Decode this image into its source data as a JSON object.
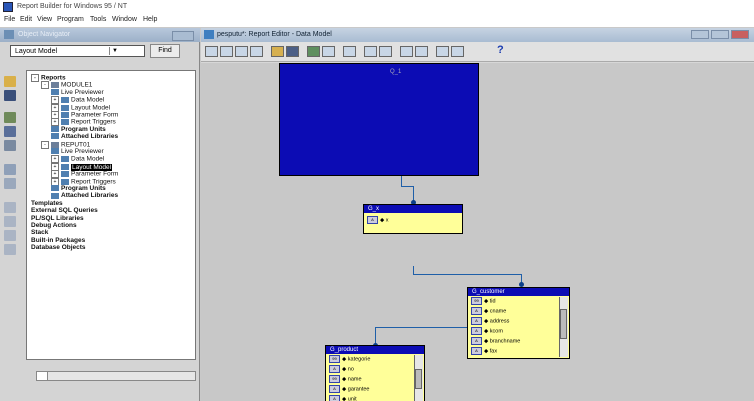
{
  "window": {
    "title": "Report Builder for Windows 95 / NT"
  },
  "menu": [
    "File",
    "Edit",
    "View",
    "Program",
    "Tools",
    "Window",
    "Help"
  ],
  "navigator": {
    "title": "Object Navigator",
    "view_select": "Layout Model",
    "find_label": "Find",
    "tree": [
      {
        "label": "Reports",
        "level": 0,
        "bold": true,
        "expander": "-"
      },
      {
        "label": "MODULE1",
        "level": 1,
        "expander": "-"
      },
      {
        "label": "Live Previewer",
        "level": 2
      },
      {
        "label": "Data Model",
        "level": 2,
        "expander": "+"
      },
      {
        "label": "Layout Model",
        "level": 2,
        "expander": "+"
      },
      {
        "label": "Parameter Form",
        "level": 2,
        "expander": "+"
      },
      {
        "label": "Report Triggers",
        "level": 2,
        "expander": "+"
      },
      {
        "label": "Program Units",
        "level": 2,
        "bold": true
      },
      {
        "label": "Attached Libraries",
        "level": 2,
        "bold": true
      },
      {
        "label": "REPUT01",
        "level": 1,
        "expander": "-"
      },
      {
        "label": "Live Previewer",
        "level": 2
      },
      {
        "label": "Data Model",
        "level": 2,
        "expander": "+"
      },
      {
        "label": "Layout Model",
        "level": 2,
        "expander": "+",
        "selected": true
      },
      {
        "label": "Parameter Form",
        "level": 2,
        "expander": "+"
      },
      {
        "label": "Report Triggers",
        "level": 2,
        "expander": "+"
      },
      {
        "label": "Program Units",
        "level": 2,
        "bold": true
      },
      {
        "label": "Attached Libraries",
        "level": 2,
        "bold": true
      },
      {
        "label": "Templates",
        "level": 0,
        "bold": true
      },
      {
        "label": "External SQL Queries",
        "level": 0,
        "bold": true
      },
      {
        "label": "PL/SQL Libraries",
        "level": 0,
        "bold": true
      },
      {
        "label": "Debug Actions",
        "level": 0,
        "bold": true
      },
      {
        "label": "Stack",
        "level": 0,
        "bold": true
      },
      {
        "label": "Built-in Packages",
        "level": 0,
        "bold": true
      },
      {
        "label": "Database Objects",
        "level": 0,
        "bold": true
      }
    ]
  },
  "editor": {
    "title": "pesputu*: Report Editor - Data Model",
    "help_label": "?",
    "query_label": "Q_1",
    "groups": [
      {
        "name": "G_x",
        "items": [
          "x"
        ]
      },
      {
        "name": "G_customer",
        "items": [
          "tid",
          "cname",
          "address",
          "kcom",
          "branchname",
          "fax"
        ]
      },
      {
        "name": "G_product",
        "items": [
          "kategorie",
          "no",
          "name",
          "garantee",
          "unit"
        ]
      }
    ]
  },
  "colors": {
    "query_fill": "#0c0cb4",
    "group_fill": "#ffff99",
    "link": "#1f5fa8"
  }
}
